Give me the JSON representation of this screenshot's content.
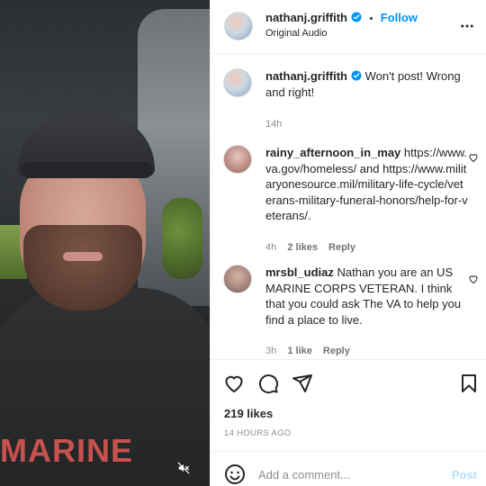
{
  "post": {
    "author": "nathanj.griffith",
    "follow_label": "Follow",
    "separator": "•",
    "audio": "Original Audio",
    "more_icon": "more-horizontal-icon",
    "verified_icon": "verified-badge-icon"
  },
  "video": {
    "shirt_text": "MARINE",
    "mute_icon": "speaker-muted-icon"
  },
  "caption": {
    "author": "nathanj.griffith",
    "text": "Won't post! Wrong and right!",
    "time": "14h"
  },
  "comments": [
    {
      "author": "rainy_afternoon_in_may",
      "text": "https://www.va.gov/homeless/ and https://www.militaryonesource.mil/military-life-cycle/veterans-military-funeral-honors/help-for-veterans/.",
      "time": "4h",
      "likes": "2 likes",
      "reply": "Reply"
    },
    {
      "author": "mrsbl_udiaz",
      "text": "Nathan you are an US MARINE CORPS VETERAN. I think that you could ask The VA to help you find a place to live.",
      "time": "3h",
      "likes": "1 like",
      "reply": "Reply"
    }
  ],
  "actions": {
    "like_icon": "heart-icon",
    "comment_icon": "comment-icon",
    "share_icon": "send-icon",
    "save_icon": "bookmark-icon",
    "likes": "219 likes",
    "time_ago": "14 HOURS AGO"
  },
  "composer": {
    "emoji_icon": "emoji-icon",
    "placeholder": "Add a comment...",
    "post_label": "Post"
  },
  "colors": {
    "accent": "#0095f6",
    "post_disabled": "#b2dffc",
    "text": "#262626",
    "secondary": "#8e8e8e"
  }
}
